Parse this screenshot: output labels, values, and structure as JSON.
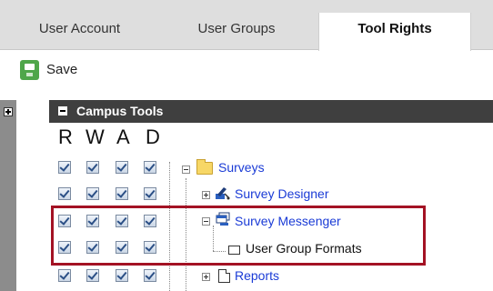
{
  "tabs": [
    {
      "label": "User Account"
    },
    {
      "label": "User Groups"
    },
    {
      "label": "Tool Rights"
    }
  ],
  "toolbar": {
    "save_label": "Save",
    "save_icon": "save-icon"
  },
  "tree": {
    "header": "Campus Tools",
    "columns": [
      "R",
      "W",
      "A",
      "D"
    ],
    "nodes": [
      {
        "label": "Surveys",
        "icon": "folder-icon",
        "checked": [
          true,
          true,
          true,
          true
        ]
      },
      {
        "label": "Survey Designer",
        "icon": "designer-icon",
        "checked": [
          true,
          true,
          true,
          true
        ]
      },
      {
        "label": "Survey Messenger",
        "icon": "messenger-icon",
        "checked": [
          true,
          true,
          true,
          true
        ]
      },
      {
        "label": "User Group Formats",
        "icon": "page-icon",
        "checked": [
          true,
          true,
          true,
          true
        ]
      },
      {
        "label": "Reports",
        "icon": "page-icon",
        "checked": [
          true,
          true,
          true,
          true
        ]
      }
    ]
  },
  "colors": {
    "highlight": "#a31224",
    "link": "#1a3bd6",
    "header_bg": "#3f3f3f",
    "tabbar_bg": "#dedede"
  }
}
